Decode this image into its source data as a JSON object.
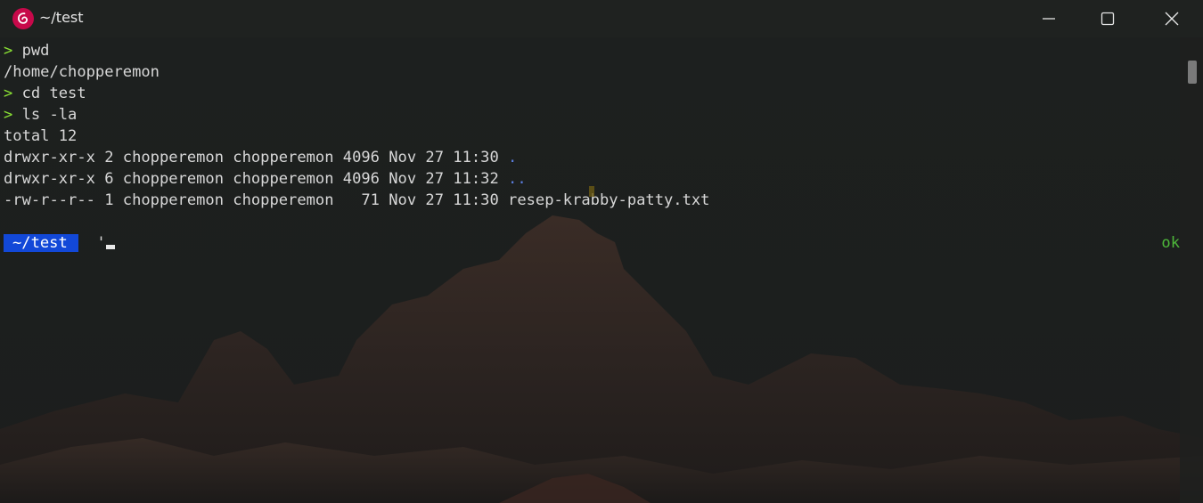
{
  "window": {
    "title": "~/test",
    "app_icon": "debian-swirl-icon",
    "controls": {
      "minimize": "minimize-icon",
      "maximize": "maximize-icon",
      "close": "close-icon"
    }
  },
  "terminal": {
    "lines": [
      {
        "prompt": ">",
        "text": " pwd"
      },
      {
        "text": "/home/chopperemon"
      },
      {
        "prompt": ">",
        "text": " cd test"
      },
      {
        "prompt": ">",
        "text": " ls -la"
      },
      {
        "text": "total 12"
      },
      {
        "text": "drwxr-xr-x 2 chopperemon chopperemon 4096 Nov 27 11:30 ",
        "name": "."
      },
      {
        "text": "drwxr-xr-x 6 chopperemon chopperemon 4096 Nov 27 11:32 ",
        "name": ".."
      },
      {
        "text": "-rw-r--r-- 1 chopperemon chopperemon   71 Nov 27 11:30 ",
        "name": "resep-krabby-patty.txt"
      }
    ],
    "prompt_line": {
      "path": "~/test",
      "input": "'",
      "status": "ok"
    }
  },
  "colors": {
    "prompt_arrow": "#8ae234",
    "directory": "#5c7fe0",
    "path_segment_bg": "#1248d8",
    "status_ok": "#4db83a",
    "text": "#d7d7d7"
  }
}
